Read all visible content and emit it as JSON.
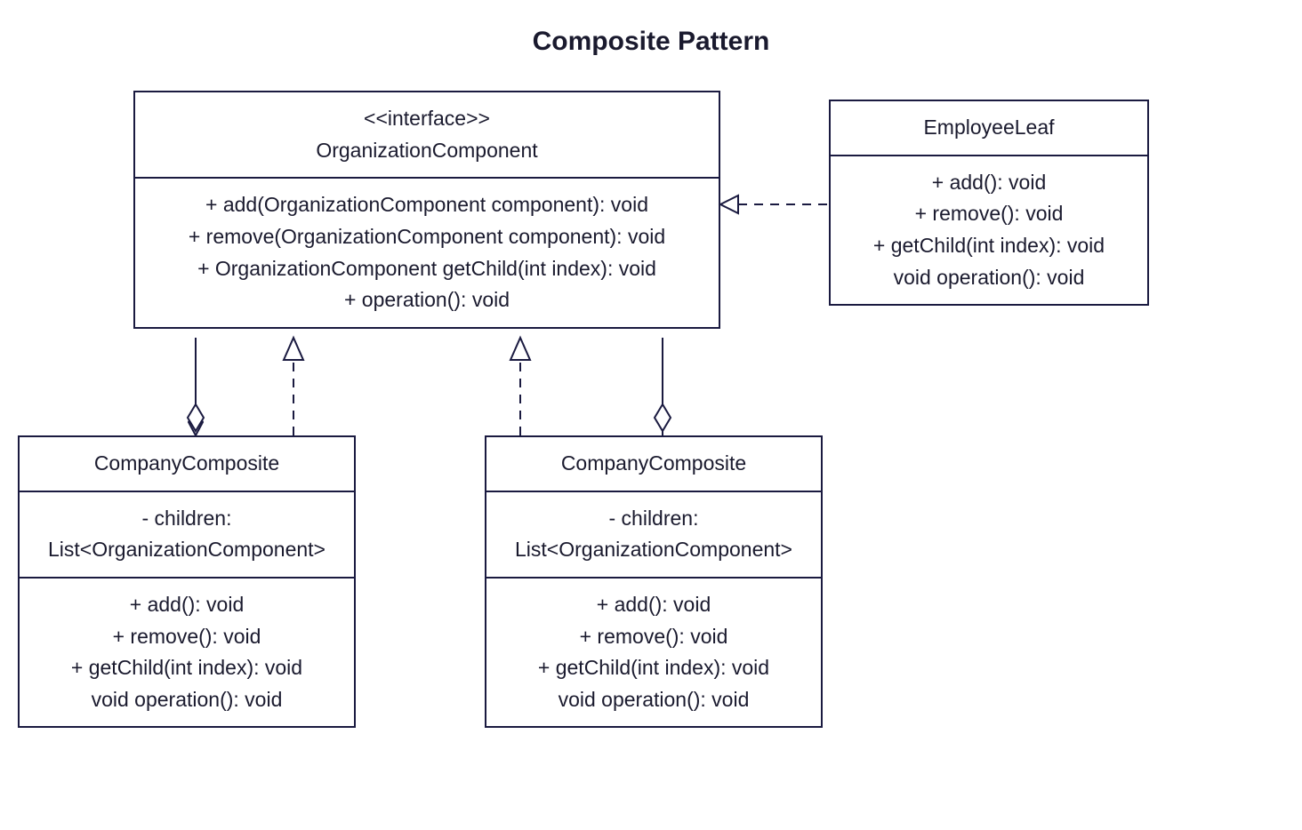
{
  "title": "Composite Pattern",
  "interface": {
    "stereotype": "<<interface>>",
    "name": "OrganizationComponent",
    "methods": [
      "+  add(OrganizationComponent component): void",
      "+  remove(OrganizationComponent component): void",
      "+  OrganizationComponent getChild(int index): void",
      "+  operation(): void"
    ]
  },
  "employeeLeaf": {
    "name": "EmployeeLeaf",
    "methods": [
      "+  add(): void",
      "+  remove(): void",
      "+  getChild(int index): void",
      "void operation(): void"
    ]
  },
  "companyComposite1": {
    "name": "CompanyComposite",
    "attributes": [
      "-   children:",
      "List<OrganizationComponent>"
    ],
    "methods": [
      "+  add(): void",
      "+  remove(): void",
      "+  getChild(int index): void",
      "void operation(): void"
    ]
  },
  "companyComposite2": {
    "name": "CompanyComposite",
    "attributes": [
      "-   children:",
      "List<OrganizationComponent>"
    ],
    "methods": [
      "+  add(): void",
      "+  remove(): void",
      "+  getChild(int index): void",
      "void operation(): void"
    ]
  }
}
